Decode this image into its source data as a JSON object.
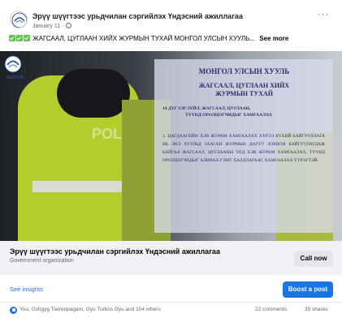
{
  "post": {
    "page_name": "Эрүү шүүгтээс урьдчилан сэргийлэх Үндэсний ажиллагаа",
    "date": "January 11 ·",
    "text": "ЖАГСААЛ, ЦУГЛААН ХИЙХ ЖУРМЫН ТУХАЙ МОНГОЛ УЛСЫН ХУУЛЬ...",
    "see_more": "See more",
    "more_icon": "more-horizontal-icon",
    "privacy_icon": "globe-icon",
    "emoji": [
      "check-mark-emoji",
      "check-mark-emoji",
      "check-mark-emoji"
    ]
  },
  "image": {
    "logo_caption": "ЭШУСҮА",
    "polic_text": "POLICE",
    "doc_title": "МОНГОЛ УЛСЫН ХУУЛЬ",
    "doc_subtitle_1": "ЖАГСААЛ, ЦУГЛААН ХИЙХ",
    "doc_subtitle_2": "ЖУРМЫН ТУХАЙ",
    "doc_section_1": "14 ДҮГЭЭР ЗҮЙЛ. ЖАГСААЛ, ЦУГЛААН,",
    "doc_section_2": "ТҮҮНД ОРОЛЦОГЧИДЫГ ХАМГААЛАХ",
    "doc_body": "1. ЦАГДААГИЙН ХЭВ ЖУРАМ ХАМГААЛАХ ХҮРЭЭ БҮХИЙ БАЙГУУЛЛАГА НЬ ЭНЭ ХУУЛЬД ЗААСАН ЖУРМЫН ДАГУУ ЗОХИОН БАЙГУУЛАГДАЖ БАЙГАА ЖАГСААЛ, ЦУГЛААНЫ ҮЕД ХЭВ ЖУРАМ ХАМГААЛАХ, ТҮҮНД ОРОЛЦОГЧИДЫГ АЛИВАА ГЭМТ ХАЛДЛАГААС ХАМГААЛАХ ҮҮРЭГТЭЙ."
  },
  "card": {
    "name": "Эрүү шүүгтээс урьдчилан сэргийлэх Үндэсний ажиллагаа",
    "category": "Government organization",
    "call_button": "Call now"
  },
  "actions": {
    "see_insights": "See insights",
    "boost_button": "Boost a post"
  },
  "reactions": {
    "icon": "like-icon",
    "names": "You, Oshgyg Tserenpagam, Oyu Turkos Oyu and 104 others",
    "comments": "22 comments",
    "shares": "35 shares"
  },
  "colors": {
    "accent": "#1b74e4",
    "link": "#216fdb",
    "card_bg": "#f0f2f5"
  }
}
